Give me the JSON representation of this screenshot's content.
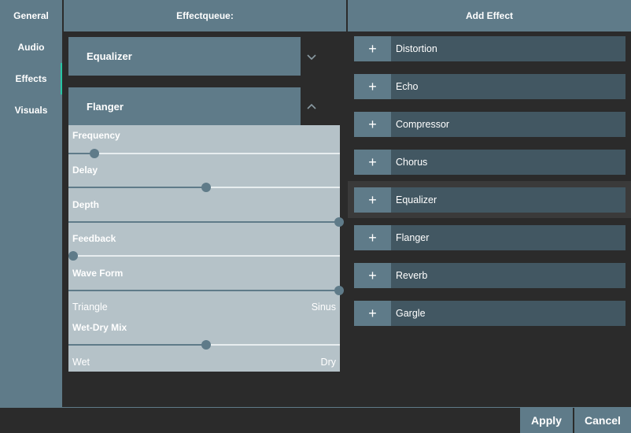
{
  "sidebar": {
    "items": [
      {
        "label": "General"
      },
      {
        "label": "Audio"
      },
      {
        "label": "Effects"
      },
      {
        "label": "Visuals"
      }
    ],
    "active": "Effects",
    "accent": "#27c5a3"
  },
  "queue": {
    "title": "Effectqueue:",
    "items": [
      {
        "label": "Equalizer",
        "expanded": false,
        "chevron": "chevron-down-icon"
      },
      {
        "label": "Flanger",
        "expanded": true,
        "chevron": "chevron-up-icon"
      }
    ],
    "flanger_params": {
      "frequency": {
        "label": "Frequency",
        "value": 0.08
      },
      "delay": {
        "label": "Delay",
        "value": 0.5
      },
      "depth": {
        "label": "Depth",
        "value": 1.0
      },
      "feedback": {
        "label": "Feedback",
        "value": 0.0
      },
      "waveform": {
        "label": "Wave Form",
        "value": 1.0,
        "min_label": "Triangle",
        "max_label": "Sinus"
      },
      "wetdry": {
        "label": "Wet-Dry Mix",
        "value": 0.5,
        "min_label": "Wet",
        "max_label": "Dry"
      }
    }
  },
  "add_effect": {
    "title": "Add Effect",
    "add_symbol": "+",
    "items": [
      {
        "label": "Distortion"
      },
      {
        "label": "Echo"
      },
      {
        "label": "Compressor"
      },
      {
        "label": "Chorus"
      },
      {
        "label": "Equalizer"
      },
      {
        "label": "Flanger"
      },
      {
        "label": "Reverb"
      },
      {
        "label": "Gargle"
      }
    ]
  },
  "footer": {
    "apply_label": "Apply",
    "cancel_label": "Cancel"
  },
  "colors": {
    "panel": "#5f7b89",
    "dark_row": "#425762",
    "slider_panel": "#b5c2c8",
    "background": "#2b2b2b"
  }
}
